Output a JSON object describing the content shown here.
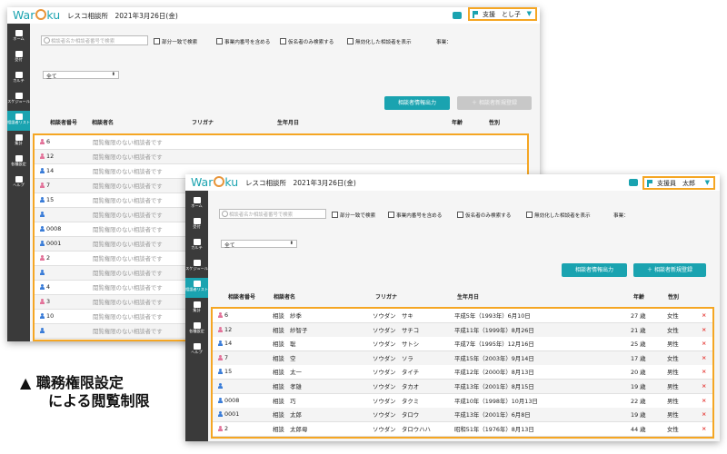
{
  "back": {
    "logo_prefix": "War",
    "logo_suffix": "ku",
    "office": "レスコ相談所　2021年3月26日(金)",
    "user": "支援　とし子",
    "caret": "▼",
    "nav": [
      {
        "label": "ホーム",
        "icon": "home-icon"
      },
      {
        "label": "受付",
        "icon": "reception-icon"
      },
      {
        "label": "カルテ",
        "icon": "chart-icon"
      },
      {
        "label": "スケジュール",
        "icon": "calendar-icon"
      },
      {
        "label": "相談者リスト",
        "icon": "users-icon",
        "active": true
      },
      {
        "label": "集計",
        "icon": "stats-icon"
      },
      {
        "label": "各種設定",
        "icon": "tools-icon"
      },
      {
        "label": "ヘルプ",
        "icon": "help-icon"
      }
    ],
    "search_placeholder": "相談者名か相談者番号で検索",
    "checks": [
      "部分一致で検索",
      "事業内番号を含める",
      "仮名者のみ検索する",
      "無効化した相談者を表示"
    ],
    "business_label": "事業：",
    "select_value": "全て",
    "btn_export": "相談者情報出力",
    "btn_new": "＋ 相談者新規登録",
    "headers": [
      "相談者番号",
      "相談者名",
      "フリガナ",
      "生年月日",
      "年齢",
      "性別"
    ],
    "rows": [
      {
        "gender": "f",
        "id": "6",
        "text": "閲覧権限のない相談者です"
      },
      {
        "gender": "f",
        "id": "12",
        "text": "閲覧権限のない相談者です"
      },
      {
        "gender": "m",
        "id": "14",
        "text": "閲覧権限のない相談者です"
      },
      {
        "gender": "f",
        "id": "7",
        "text": "閲覧権限のない相談者です"
      },
      {
        "gender": "m",
        "id": "15",
        "text": "閲覧権限のない相談者です"
      },
      {
        "gender": "m",
        "id": "",
        "text": "閲覧権限のない相談者です"
      },
      {
        "gender": "m",
        "id": "0008",
        "text": "閲覧権限のない相談者です"
      },
      {
        "gender": "m",
        "id": "0001",
        "text": "閲覧権限のない相談者です"
      },
      {
        "gender": "f",
        "id": "2",
        "text": "閲覧権限のない相談者です"
      },
      {
        "gender": "m",
        "id": "",
        "text": "閲覧権限のない相談者です"
      },
      {
        "gender": "m",
        "id": "4",
        "text": "閲覧権限のない相談者です"
      },
      {
        "gender": "f",
        "id": "3",
        "text": "閲覧権限のない相談者です"
      },
      {
        "gender": "m",
        "id": "10",
        "text": "閲覧権限のない相談者です"
      },
      {
        "gender": "m",
        "id": "",
        "text": "閲覧権限のない相談者です"
      }
    ]
  },
  "front": {
    "logo_prefix": "War",
    "logo_suffix": "ku",
    "office": "レスコ相談所　2021年3月26日(金)",
    "user": "支援員　太郎",
    "caret": "▼",
    "nav": [
      {
        "label": "ホーム",
        "icon": "home-icon"
      },
      {
        "label": "受付",
        "icon": "reception-icon"
      },
      {
        "label": "カルテ",
        "icon": "chart-icon"
      },
      {
        "label": "スケジュール",
        "icon": "calendar-icon"
      },
      {
        "label": "相談者リスト",
        "icon": "users-icon",
        "active": true
      },
      {
        "label": "集計",
        "icon": "stats-icon"
      },
      {
        "label": "各種設定",
        "icon": "tools-icon"
      },
      {
        "label": "ヘルプ",
        "icon": "help-icon"
      }
    ],
    "search_placeholder": "相談者名か相談者番号で検索",
    "checks": [
      "部分一致で検索",
      "事業内番号を含める",
      "仮名者のみ検索する",
      "無効化した相談者を表示"
    ],
    "business_label": "事業：",
    "select_value": "全て",
    "btn_export": "相談者情報出力",
    "btn_new": "＋ 相談者新規登録",
    "headers": [
      "相談者番号",
      "相談者名",
      "フリガナ",
      "生年月日",
      "年齢",
      "性別"
    ],
    "rows": [
      {
        "gender": "f",
        "id": "6",
        "name": "相談　紗季",
        "kana": "ソウダン　サキ",
        "birth": "平成5年（1993年）6月10日",
        "age": "27 歳",
        "sex": "女性"
      },
      {
        "gender": "f",
        "id": "12",
        "name": "相談　紗智子",
        "kana": "ソウダン　サチコ",
        "birth": "平成11年（1999年）8月26日",
        "age": "21 歳",
        "sex": "女性"
      },
      {
        "gender": "m",
        "id": "14",
        "name": "相談　聡",
        "kana": "ソウダン　サトシ",
        "birth": "平成7年（1995年）12月16日",
        "age": "25 歳",
        "sex": "男性"
      },
      {
        "gender": "f",
        "id": "7",
        "name": "相談　空",
        "kana": "ソウダン　ソラ",
        "birth": "平成15年（2003年）9月14日",
        "age": "17 歳",
        "sex": "女性"
      },
      {
        "gender": "m",
        "id": "15",
        "name": "相談　太一",
        "kana": "ソウダン　タイチ",
        "birth": "平成12年（2000年）8月13日",
        "age": "20 歳",
        "sex": "男性"
      },
      {
        "gender": "m",
        "id": "",
        "name": "相談　孝雄",
        "kana": "ソウダン　タカオ",
        "birth": "平成13年（2001年）8月15日",
        "age": "19 歳",
        "sex": "男性"
      },
      {
        "gender": "m",
        "id": "0008",
        "name": "相談　巧",
        "kana": "ソウダン　タクミ",
        "birth": "平成10年（1998年）10月13日",
        "age": "22 歳",
        "sex": "男性"
      },
      {
        "gender": "m",
        "id": "0001",
        "name": "相談　太郎",
        "kana": "ソウダン　タロウ",
        "birth": "平成13年（2001年）6月8日",
        "age": "19 歳",
        "sex": "男性"
      },
      {
        "gender": "f",
        "id": "2",
        "name": "相談　太郎母",
        "kana": "ソウダン　タロウハハ",
        "birth": "昭和51年（1976年）8月13日",
        "age": "44 歳",
        "sex": "女性"
      }
    ],
    "delete_mark": "×"
  },
  "caption": {
    "marker": "▲",
    "line1": "職務権限設定",
    "line2": "による閲覧制限"
  },
  "colors": {
    "accent": "#1aa3b0",
    "highlight": "#f5a623",
    "female": "#e3739a",
    "male": "#3b7dd8",
    "delete": "#e53935",
    "sidebar": "#3a3a3a"
  }
}
